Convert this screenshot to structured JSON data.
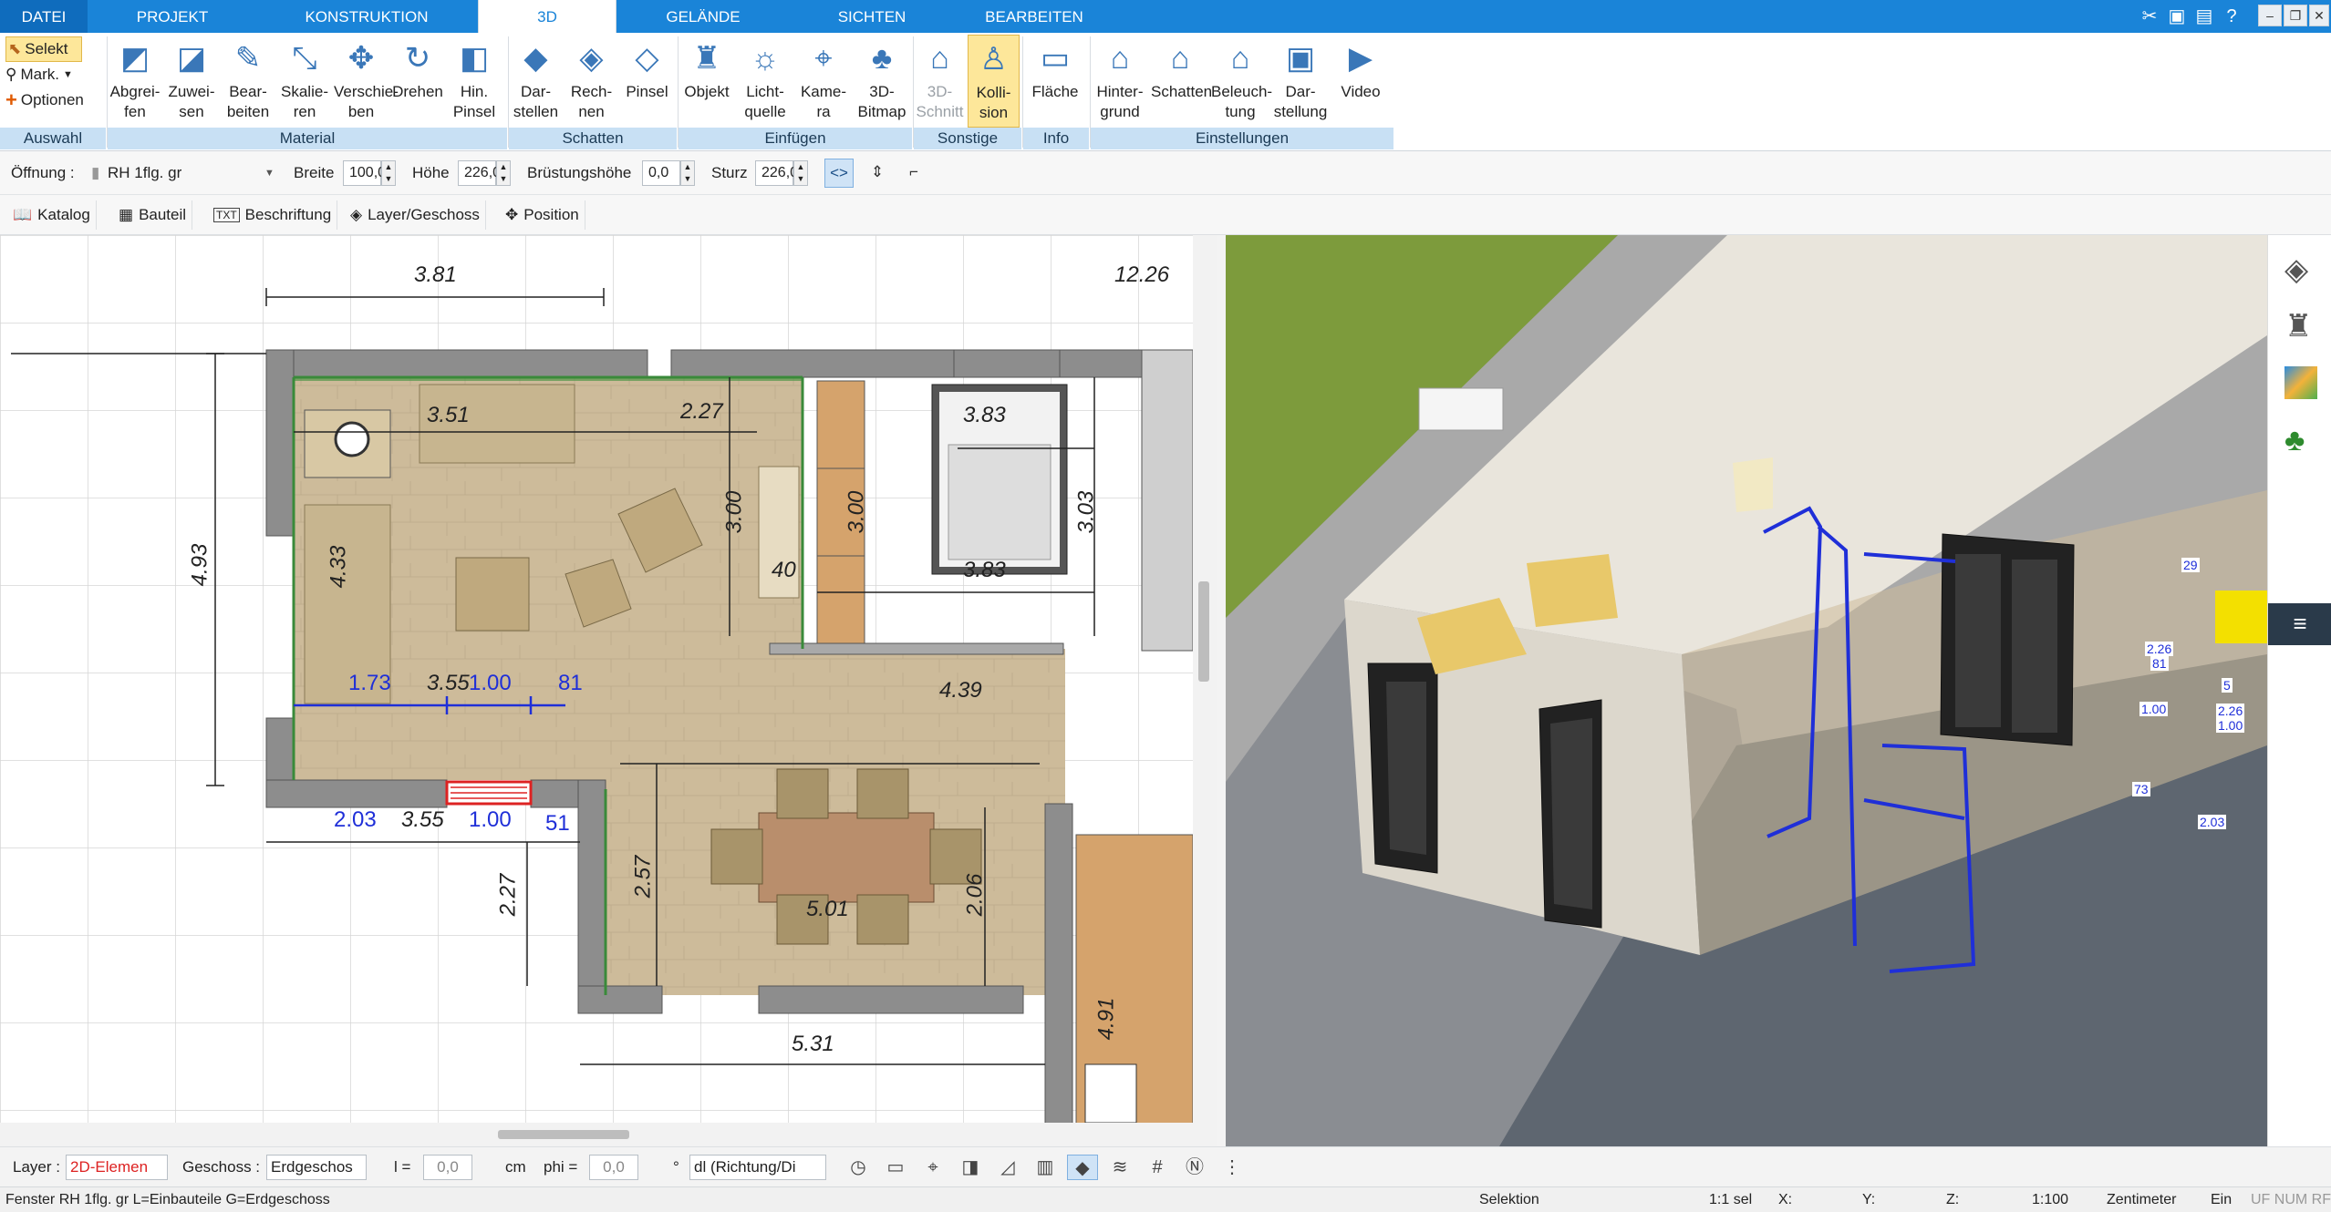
{
  "menu": {
    "tabs": [
      "DATEI",
      "PROJEKT",
      "KONSTRUKTION",
      "3D",
      "GELÄNDE",
      "SICHTEN",
      "BEARBEITEN"
    ]
  },
  "ribbon": {
    "auswahl": {
      "selekt": "Selekt",
      "mark": "Mark.",
      "optionen": "Optionen",
      "group": "Auswahl"
    },
    "material": {
      "group": "Material",
      "items": [
        [
          "Abgrei-",
          "fen"
        ],
        [
          "Zuwei-",
          "sen"
        ],
        [
          "Bear-",
          "beiten"
        ],
        [
          "Skalie-",
          "ren"
        ],
        [
          "Verschie-",
          "ben"
        ],
        [
          "Drehen",
          ""
        ],
        [
          "Hin.",
          "Pinsel"
        ]
      ]
    },
    "schatten": {
      "group": "Schatten",
      "items": [
        [
          "Dar-",
          "stellen"
        ],
        [
          "Rech-",
          "nen"
        ],
        [
          "Pinsel",
          ""
        ]
      ]
    },
    "einfuegen": {
      "group": "Einfügen",
      "items": [
        [
          "Objekt",
          ""
        ],
        [
          "Licht-",
          "quelle"
        ],
        [
          "Kame-",
          "ra"
        ],
        [
          "3D-",
          "Bitmap"
        ]
      ]
    },
    "sonstige": {
      "group": "Sonstige",
      "items": [
        [
          "3D-",
          "Schnitt"
        ],
        [
          "Kolli-",
          "sion"
        ]
      ]
    },
    "info": {
      "group": "Info",
      "items": [
        [
          "Fläche",
          ""
        ]
      ]
    },
    "einstellungen": {
      "group": "Einstellungen",
      "items": [
        [
          "Hinter-",
          "grund"
        ],
        [
          "Schatten",
          ""
        ],
        [
          "Beleuch-",
          "tung"
        ],
        [
          "Dar-",
          "stellung"
        ],
        [
          "Video",
          ""
        ]
      ]
    }
  },
  "props": {
    "oeffnung_label": "Öffnung :",
    "oeffnung_value": "RH 1flg. gr",
    "breite_label": "Breite",
    "breite_value": "100,0",
    "hoehe_label": "Höhe",
    "hoehe_value": "226,0",
    "bruestung_label": "Brüstungshöhe",
    "bruestung_value": "0,0",
    "sturz_label": "Sturz",
    "sturz_value": "226,0"
  },
  "toolbar": {
    "katalog": "Katalog",
    "bauteil": "Bauteil",
    "beschriftung": "Beschriftung",
    "txt": "TXT",
    "layer": "Layer/Geschoss",
    "position": "Position"
  },
  "plan": {
    "dims": {
      "d381": "3.81",
      "d1226": "12.26",
      "d351": "3.51",
      "d227a": "2.27",
      "d383a": "3.83",
      "d383b": "3.83",
      "d300a": "3.00",
      "d300b": "3.00",
      "d303": "3.03",
      "d433": "4.33",
      "d493": "4.93",
      "d40": "40",
      "d173": "1.73",
      "d355a": "3.55",
      "d100a": "1.00",
      "d81": "81",
      "d439": "4.39",
      "d203": "2.03",
      "d355b": "3.55",
      "d100b": "1.00",
      "d51": "51",
      "d227b": "2.27",
      "d257": "2.57",
      "d501": "5.01",
      "d206": "2.06",
      "d531": "5.31",
      "d491": "4.91"
    }
  },
  "view3d": {
    "labels": [
      "29",
      "2.26",
      "81",
      "1.00",
      "73",
      "5",
      "2.26",
      "1.00",
      "2.03"
    ]
  },
  "bottom": {
    "layer_label": "Layer :",
    "layer_value": "2D-Elemen",
    "geschoss_label": "Geschoss :",
    "geschoss_value": "Erdgeschos",
    "l_label": "l =",
    "l_value": "0,0",
    "cm": "cm",
    "phi_label": "phi =",
    "phi_value": "0,0",
    "deg": "°",
    "dl_value": "dl (Richtung/Di"
  },
  "status": {
    "left": "Fenster RH 1flg. gr L=Einbauteile G=Erdgeschoss",
    "selektion": "Selektion",
    "sel": "1:1 sel",
    "x": "X:",
    "y": "Y:",
    "z": "Z:",
    "scale": "1:100",
    "unit": "Zentimeter",
    "ein": "Ein",
    "flags": "UF NUM RF"
  },
  "colors": {
    "accent": "#1a84d8",
    "ribbon_group": "#c8e0f4",
    "highlight": "#fde79a",
    "dim_blue": "#1f2fd8",
    "wall": "#8d8d8d",
    "floor": "#cdbb9a"
  }
}
